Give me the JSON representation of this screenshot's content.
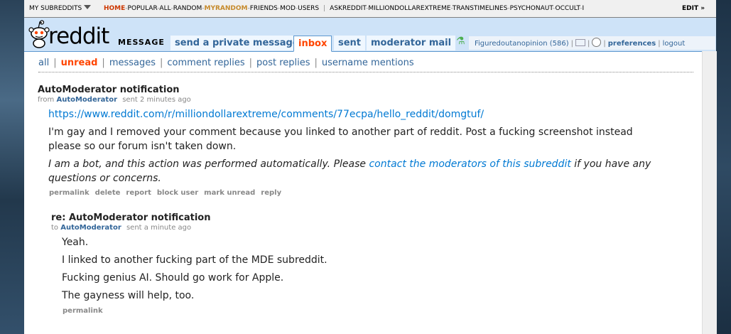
{
  "srbar": {
    "my_subreddits": "MY SUBREDDITS",
    "links": [
      "HOME",
      "POPULAR",
      "ALL",
      "RANDOM",
      "MYRANDOM",
      "FRIENDS",
      "MOD",
      "USERS"
    ],
    "subs": [
      "ASKREDDIT",
      "MILLIONDOLLAREXTREME",
      "TRANSTIMELINES",
      "PSYCHONAUT",
      "OCCULT",
      "I"
    ],
    "edit": "EDIT »"
  },
  "header": {
    "logo_text": "reddit",
    "page_name": "MESSAGE",
    "tabs": [
      "send a private message",
      "inbox",
      "sent",
      "moderator mail"
    ],
    "selected_tab": "inbox"
  },
  "user": {
    "name": "Figuredoutanopinion",
    "karma": "(586)",
    "preferences": "preferences",
    "logout": "logout"
  },
  "menu": {
    "items": [
      "all",
      "unread",
      "messages",
      "comment replies",
      "post replies",
      "username mentions"
    ],
    "selected": "unread"
  },
  "messages": [
    {
      "subject": "AutoModerator notification",
      "tag_prefix": "from",
      "author": "AutoModerator",
      "time": "sent 2 minutes ago",
      "link": "https://www.reddit.com/r/milliondollarextreme/comments/77ecpa/hello_reddit/domgtuf/",
      "para1": "I'm gay and I removed your comment because you linked to another part of reddit. Post a fucking screenshot instead please so our forum isn't taken down.",
      "para2_a": "I am a bot, and this action was performed automatically. Please ",
      "para2_link": "contact the moderators of this subreddit",
      "para2_b": " if you have any questions or concerns.",
      "buttons": [
        "permalink",
        "delete",
        "report",
        "block user",
        "mark unread",
        "reply"
      ]
    },
    {
      "subject": "re: AutoModerator notification",
      "tag_prefix": "to",
      "author": "AutoModerator",
      "time": "sent a minute ago",
      "lines": [
        "Yeah.",
        "I linked to another fucking part of the MDE subreddit.",
        "Fucking genius AI. Should go work for Apple.",
        "The gayness will help, too."
      ],
      "buttons": [
        "permalink"
      ]
    }
  ],
  "colors": {
    "accent": "#ff4500",
    "link": "#336699",
    "header_bg": "#cee3f8"
  }
}
